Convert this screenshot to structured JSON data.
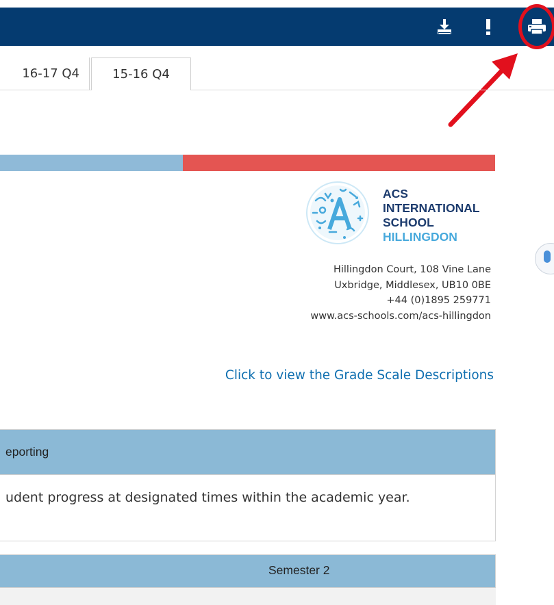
{
  "toolbar": {
    "icons": [
      "download-icon",
      "alert-icon",
      "print-icon"
    ],
    "color": "#053b70"
  },
  "tabs": [
    {
      "label": "16-17 Q4"
    },
    {
      "label": "15-16 Q4"
    }
  ],
  "color_bar": {
    "left_color": "#8fbad8",
    "right_color": "#e45552"
  },
  "school": {
    "name_lines": [
      "ACS",
      "INTERNATIONAL",
      "SCHOOL",
      "HILLINGDON"
    ],
    "address": [
      "Hillingdon Court, 108 Vine Lane",
      "Uxbridge, Middlesex, UB10 0BE",
      "+44 (0)1895 259771",
      "www.acs-schools.com/acs-hillingdon"
    ]
  },
  "grade_link": "Click to view the Grade Scale Descriptions",
  "reporting_panel": {
    "header": "eporting",
    "body": "udent progress at designated times within the academic year."
  },
  "semester_panel": {
    "header": "Semester 2"
  },
  "annotation": {
    "color": "#e2101d"
  }
}
